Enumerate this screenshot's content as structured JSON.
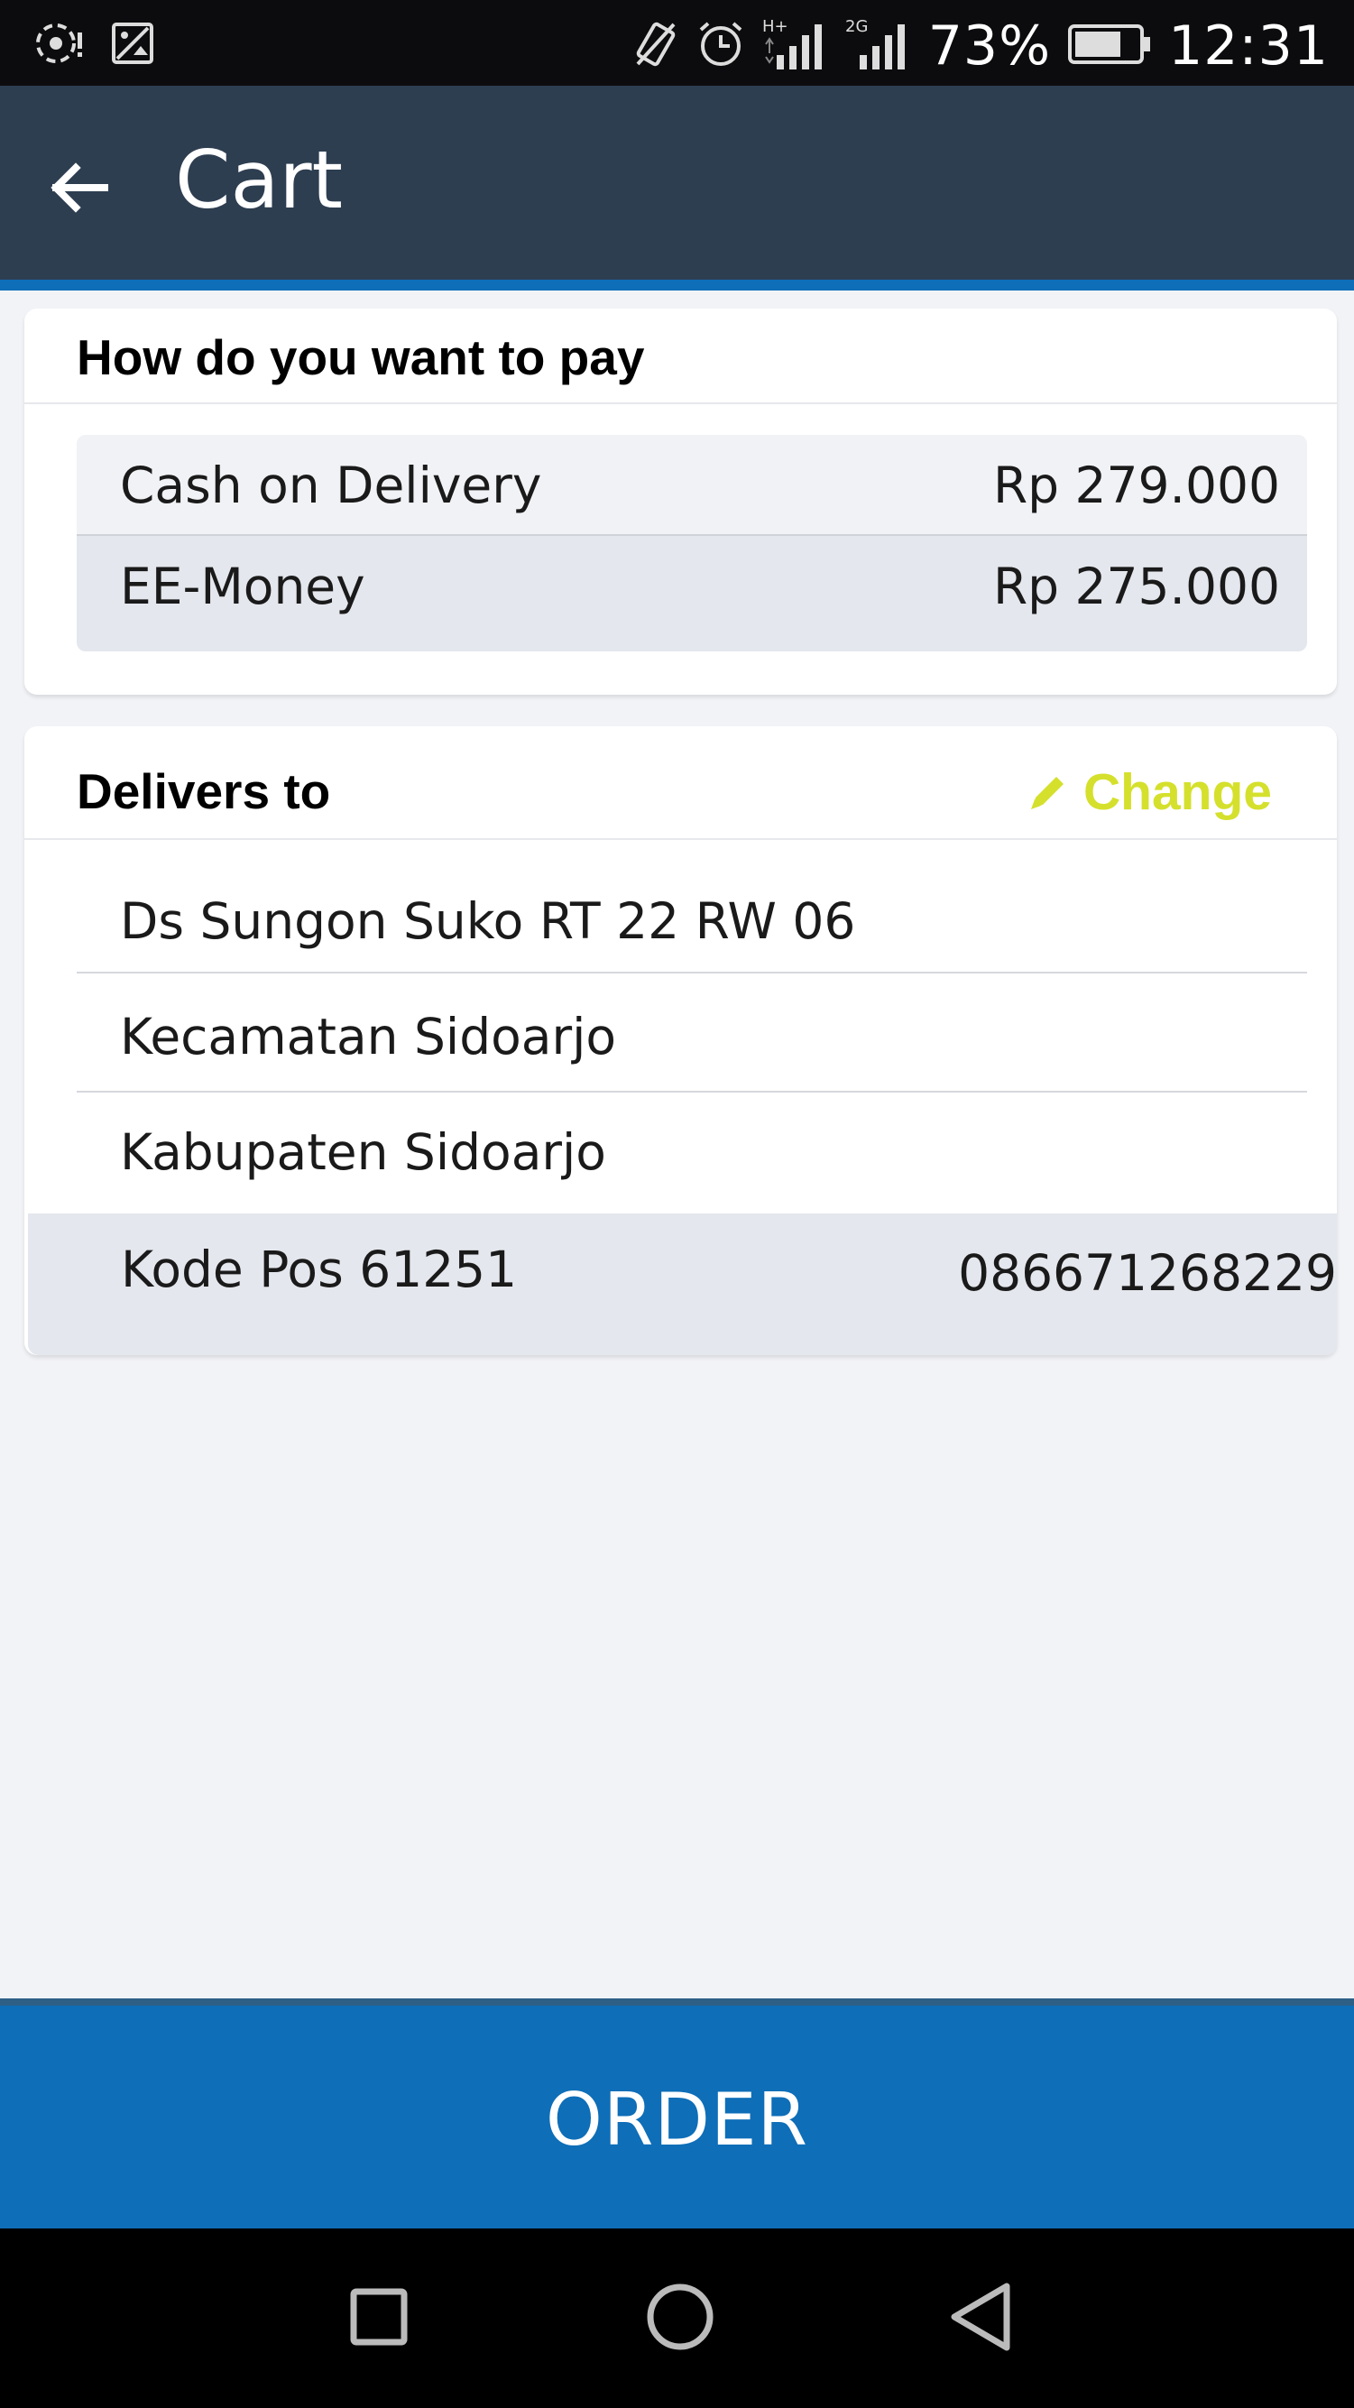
{
  "status_bar": {
    "battery": "73%",
    "time": "12:31",
    "network_1": "H+",
    "network_2": "2G"
  },
  "header": {
    "title": "Cart"
  },
  "payment": {
    "heading": "How do you want to pay",
    "options": [
      {
        "label": "Cash on Delivery",
        "amount": "Rp 279.000",
        "selected": false
      },
      {
        "label": "EE-Money",
        "amount": "Rp 275.000",
        "selected": true
      }
    ]
  },
  "delivery": {
    "heading": "Delivers to",
    "change_label": "Change",
    "address_lines": [
      "Ds Sungon Suko RT 22 RW 06",
      "Kecamatan Sidoarjo",
      "Kabupaten Sidoarjo"
    ],
    "postcode": "Kode Pos 61251",
    "phone": "086671268229"
  },
  "order_button": {
    "label": "ORDER"
  },
  "colors": {
    "app_bar": "#2e3e51",
    "accent_blue": "#0e6eb8",
    "change_yellow": "#d5e02d",
    "background": "#f2f3f7"
  },
  "icons": {
    "status_left": [
      "location-icon",
      "image-icon"
    ],
    "status_right": [
      "vibrate-icon",
      "alarm-icon",
      "signal-icon",
      "signal-icon",
      "battery-icon"
    ],
    "header": "back-arrow-icon",
    "change": "pencil-icon",
    "nav": [
      "recents-square-icon",
      "home-circle-icon",
      "back-triangle-icon"
    ]
  }
}
